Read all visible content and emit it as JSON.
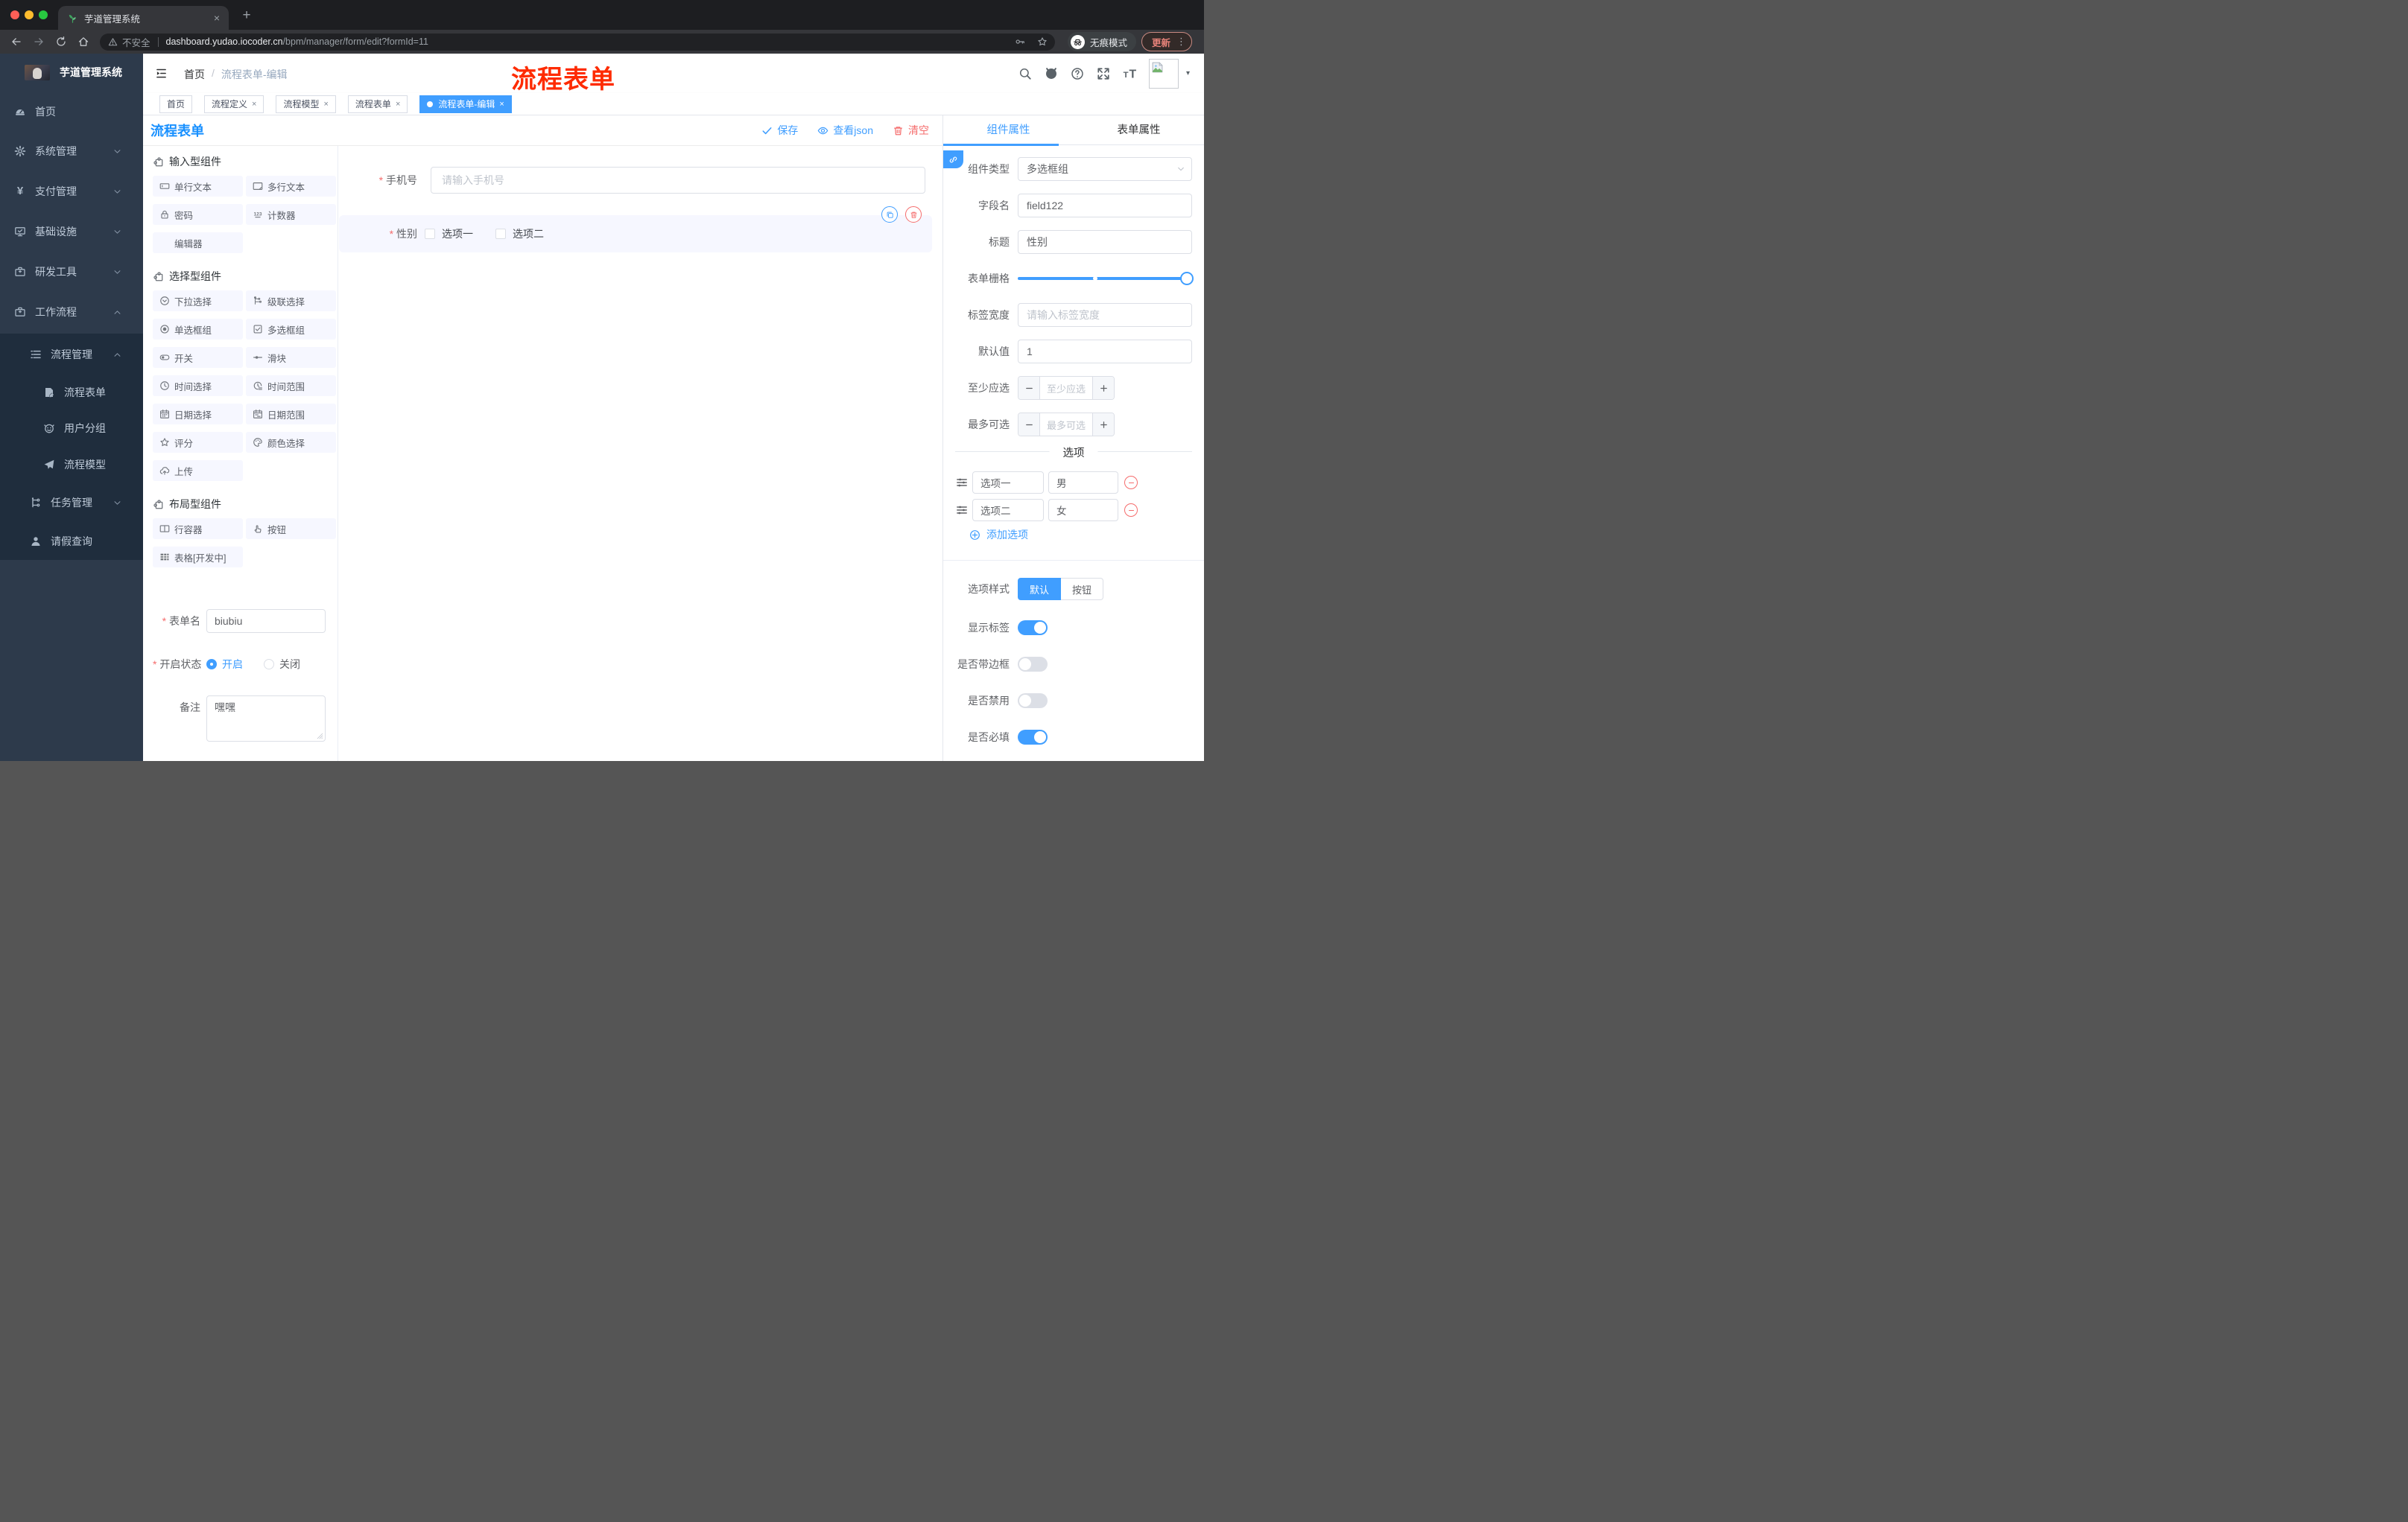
{
  "browser": {
    "tab_title": "芋道管理系统",
    "security_label": "不安全",
    "url_domain": "dashboard.yudao.iocoder.cn",
    "url_path": "/bpm/manager/form/edit?formId=11",
    "incognito_label": "无痕模式",
    "update_label": "更新"
  },
  "header": {
    "breadcrumb_home": "首页",
    "breadcrumb_sep": "/",
    "breadcrumb_current": "流程表单-编辑",
    "annotation": "流程表单"
  },
  "sidebar": {
    "app_title": "芋道管理系统",
    "items": [
      {
        "label": "首页"
      },
      {
        "label": "系统管理"
      },
      {
        "label": "支付管理"
      },
      {
        "label": "基础设施"
      },
      {
        "label": "研发工具"
      },
      {
        "label": "工作流程"
      },
      {
        "label": "流程管理"
      },
      {
        "label": "流程表单"
      },
      {
        "label": "用户分组"
      },
      {
        "label": "流程模型"
      },
      {
        "label": "任务管理"
      },
      {
        "label": "请假查询"
      }
    ]
  },
  "tags": {
    "tabs": [
      {
        "label": "首页"
      },
      {
        "label": "流程定义"
      },
      {
        "label": "流程模型"
      },
      {
        "label": "流程表单"
      },
      {
        "label": "流程表单-编辑"
      }
    ]
  },
  "builder": {
    "page_title": "流程表单",
    "save_label": "保存",
    "view_json_label": "查看json",
    "clear_label": "清空",
    "palette": {
      "sections": [
        {
          "title": "输入型组件",
          "items": [
            {
              "label": "单行文本"
            },
            {
              "label": "多行文本"
            },
            {
              "label": "密码"
            },
            {
              "label": "计数器"
            },
            {
              "label": "编辑器"
            }
          ]
        },
        {
          "title": "选择型组件",
          "items": [
            {
              "label": "下拉选择"
            },
            {
              "label": "级联选择"
            },
            {
              "label": "单选框组"
            },
            {
              "label": "多选框组"
            },
            {
              "label": "开关"
            },
            {
              "label": "滑块"
            },
            {
              "label": "时间选择"
            },
            {
              "label": "时间范围"
            },
            {
              "label": "日期选择"
            },
            {
              "label": "日期范围"
            },
            {
              "label": "评分"
            },
            {
              "label": "颜色选择"
            },
            {
              "label": "上传"
            }
          ]
        },
        {
          "title": "布局型组件",
          "items": [
            {
              "label": "行容器"
            },
            {
              "label": "按钮"
            },
            {
              "label": "表格[开发中]"
            }
          ]
        }
      ],
      "form": {
        "name_label": "表单名",
        "name_value": "biubiu",
        "status_label": "开启状态",
        "status_on": "开启",
        "status_off": "关闭",
        "remark_label": "备注",
        "remark_value": "嘿嘿"
      }
    },
    "canvas": {
      "phone_label": "手机号",
      "phone_placeholder": "请输入手机号",
      "gender_label": "性别",
      "gender_option1": "选项一",
      "gender_option2": "选项二"
    },
    "props": {
      "tab_component": "组件属性",
      "tab_form": "表单属性",
      "type_label": "组件类型",
      "type_value": "多选框组",
      "field_label": "字段名",
      "field_value": "field122",
      "title_label": "标题",
      "title_value": "性别",
      "grid_label": "表单栅格",
      "width_label": "标签宽度",
      "width_placeholder": "请输入标签宽度",
      "default_label": "默认值",
      "default_value": "1",
      "min_label": "至少应选",
      "min_placeholder": "至少应选",
      "max_label": "最多可选",
      "max_placeholder": "最多可选",
      "options_title": "选项",
      "options": [
        {
          "label": "选项一",
          "value": "男"
        },
        {
          "label": "选项二",
          "value": "女"
        }
      ],
      "add_option_label": "添加选项",
      "style_label": "选项样式",
      "style_default": "默认",
      "style_button": "按钮",
      "toggles": [
        {
          "label": "显示标签",
          "on": true
        },
        {
          "label": "是否带边框",
          "on": false
        },
        {
          "label": "是否禁用",
          "on": false
        },
        {
          "label": "是否必填",
          "on": true
        }
      ]
    }
  },
  "colors": {
    "primary": "#409eff",
    "danger": "#f56c6c",
    "page_title_blue": "#1890ff",
    "annotation_red": "#fe2b00",
    "sidebar_bg": "#2d3a4b",
    "submenu_bg": "#1f2d3d",
    "selected_field_bg": "#f6f7ff"
  }
}
